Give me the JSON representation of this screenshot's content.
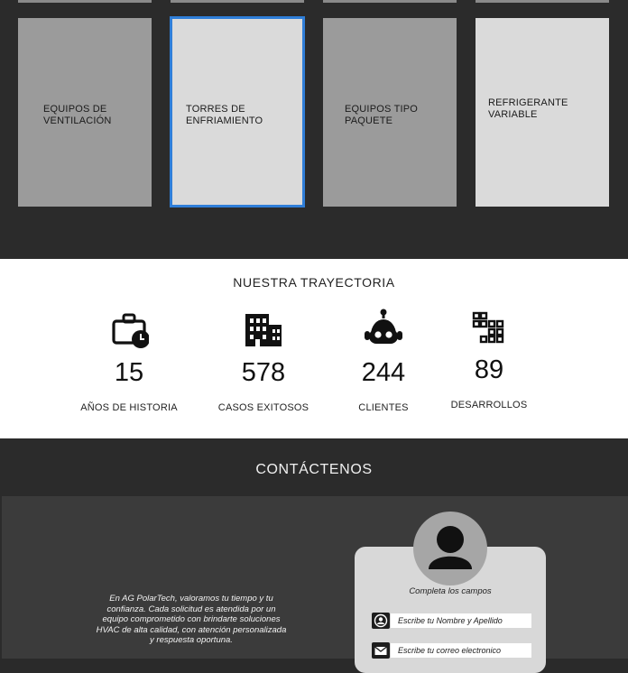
{
  "services": {
    "cards": [
      {
        "label": "EQUIPOS DE\nVENTILACIÓN"
      },
      {
        "label": "TORRES DE\nENFRIAMIENTO"
      },
      {
        "label": "EQUIPOS TIPO\nPAQUETE"
      },
      {
        "label": "REFRIGERANTE\nVARIABLE"
      }
    ]
  },
  "stats": {
    "title": "NUESTRA TRAYECTORIA",
    "items": [
      {
        "value": "15",
        "caption": "AÑOS DE HISTORIA",
        "icon": "briefcase-clock-icon"
      },
      {
        "value": "578",
        "caption": "CASOS EXITOSOS",
        "icon": "building-icon"
      },
      {
        "value": "244",
        "caption": "CLIENTES",
        "icon": "robot-icon"
      },
      {
        "value": "89",
        "caption": "DESARROLLOS",
        "icon": "blocks-icon"
      }
    ]
  },
  "contact": {
    "title": "CONTÁCTENOS",
    "paragraph": "En AG PolarTech, valoramos tu tiempo y tu\nconfianza. Cada solicitud es atendida por un\nequipo comprometido con brindarte soluciones\nHVAC de alta calidad, con atención personalizada\ny respuesta oportuna.",
    "form": {
      "hint": "Completa los campos",
      "name_placeholder": "Escribe tu Nombre y Apellido",
      "email_placeholder": "Escribe tu correo electronico"
    }
  }
}
